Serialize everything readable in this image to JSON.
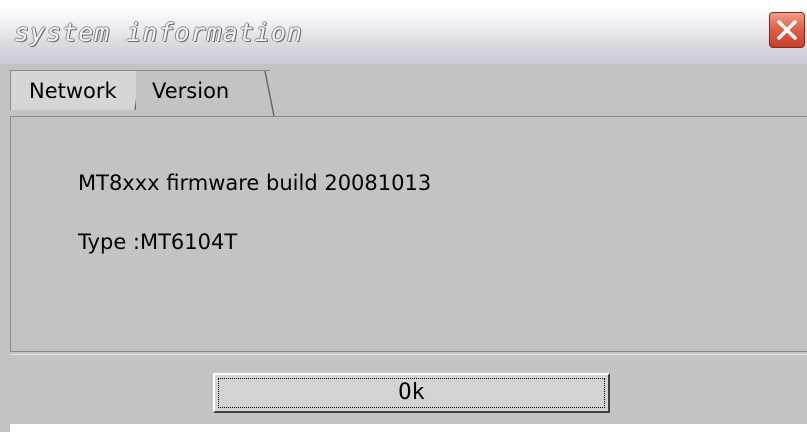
{
  "window": {
    "title": "system information",
    "close_icon": "close-icon",
    "accent_close": "#e0604a"
  },
  "tabs": [
    {
      "label": "Network",
      "active": false
    },
    {
      "label": "Version",
      "active": true
    }
  ],
  "version_panel": {
    "firmware_line": "MT8xxx firmware build 20081013",
    "type_line": "Type :MT6104T"
  },
  "footer": {
    "ok_label": "Ok"
  }
}
